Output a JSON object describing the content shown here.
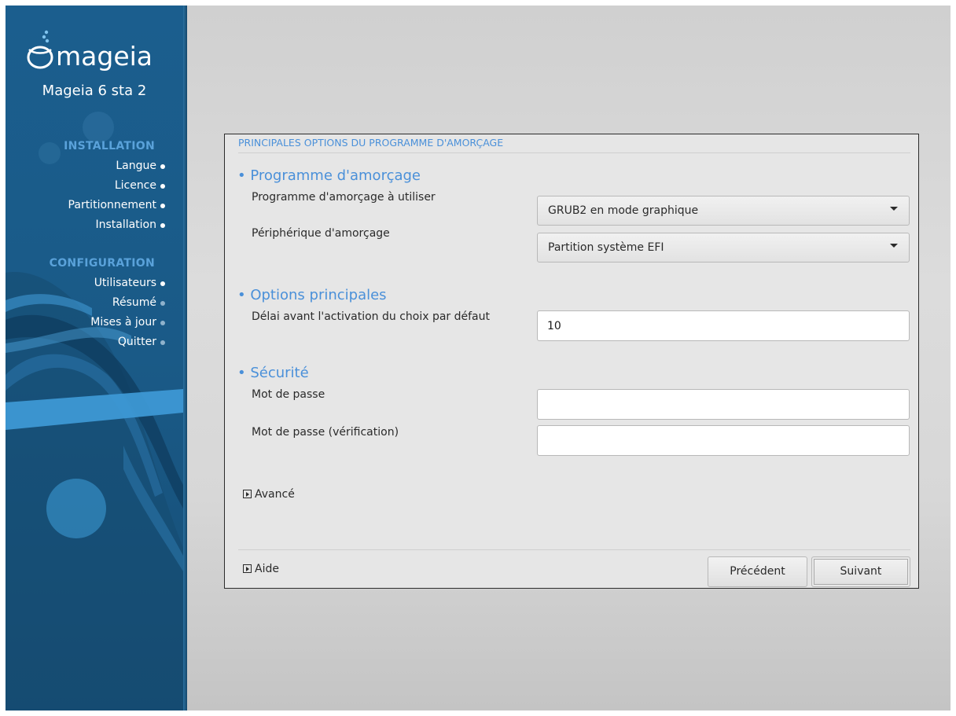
{
  "sidebar": {
    "logo_text": "mageia",
    "version": "Mageia 6 sta 2",
    "sections": [
      {
        "title": "INSTALLATION",
        "items": [
          {
            "label": "Langue",
            "done": true
          },
          {
            "label": "Licence",
            "done": true
          },
          {
            "label": "Partitionnement",
            "done": true
          },
          {
            "label": "Installation",
            "done": true
          }
        ]
      },
      {
        "title": "CONFIGURATION",
        "items": [
          {
            "label": "Utilisateurs",
            "done": true
          },
          {
            "label": "Résumé",
            "done": false
          },
          {
            "label": "Mises à jour",
            "done": false
          },
          {
            "label": "Quitter",
            "done": false
          }
        ]
      }
    ]
  },
  "dialog": {
    "title": "PRINCIPALES OPTIONS DU PROGRAMME D'AMORÇAGE",
    "groups": {
      "bootloader": {
        "heading": "• Programme d'amorçage",
        "bootloader_label": "Programme d'amorçage à utiliser",
        "bootloader_value": "GRUB2 en mode graphique",
        "device_label": "Périphérique d'amorçage",
        "device_value": "Partition système EFI"
      },
      "main_options": {
        "heading": "• Options principales",
        "delay_label": "Délai avant l'activation du choix par défaut",
        "delay_value": "10"
      },
      "security": {
        "heading": "• Sécurité",
        "password_label": "Mot de passe",
        "password_value": "",
        "password_check_label": "Mot de passe (vérification)",
        "password_check_value": ""
      }
    },
    "advanced_label": "Avancé",
    "help_label": "Aide",
    "buttons": {
      "previous": "Précédent",
      "next": "Suivant"
    }
  },
  "colors": {
    "sidebar_bg": "#1a5a87",
    "section_heading": "#5aa2da",
    "dialog_heading": "#4a90d9"
  },
  "icons": [
    "mageia-logo",
    "dropdown-arrow-icon",
    "expander-arrow-icon",
    "status-dot-icon"
  ]
}
